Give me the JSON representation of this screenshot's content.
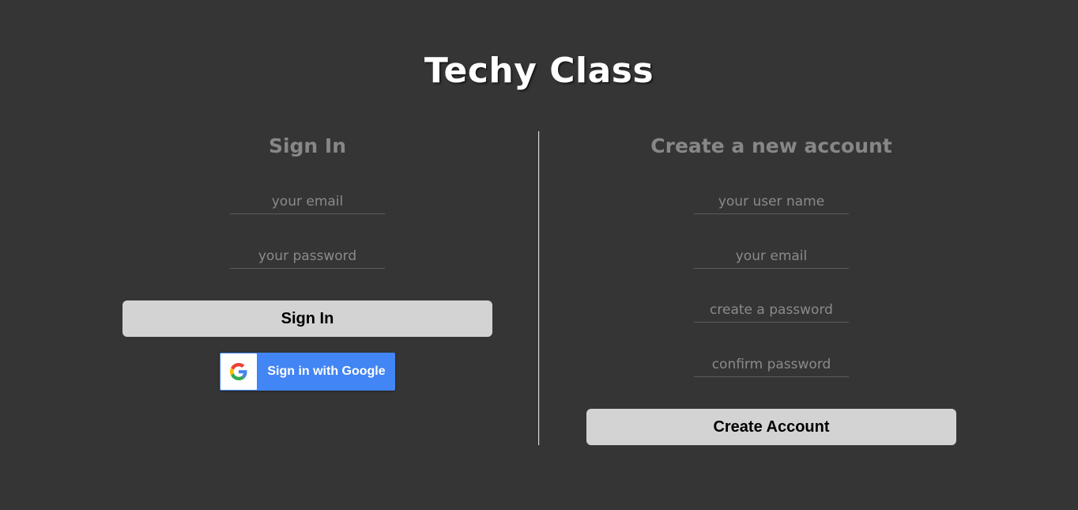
{
  "app": {
    "title": "Techy Class"
  },
  "signin": {
    "title": "Sign In",
    "email_placeholder": "your email",
    "password_placeholder": "your password",
    "button_label": "Sign In",
    "google_button_label": "Sign in with Google"
  },
  "signup": {
    "title": "Create a new account",
    "username_placeholder": "your user name",
    "email_placeholder": "your email",
    "password_placeholder": "create a password",
    "confirm_placeholder": "confirm password",
    "button_label": "Create Account"
  },
  "colors": {
    "background": "#353535",
    "button": "#d3d3d3",
    "google_blue": "#4285f4",
    "panel_title": "#878787"
  }
}
